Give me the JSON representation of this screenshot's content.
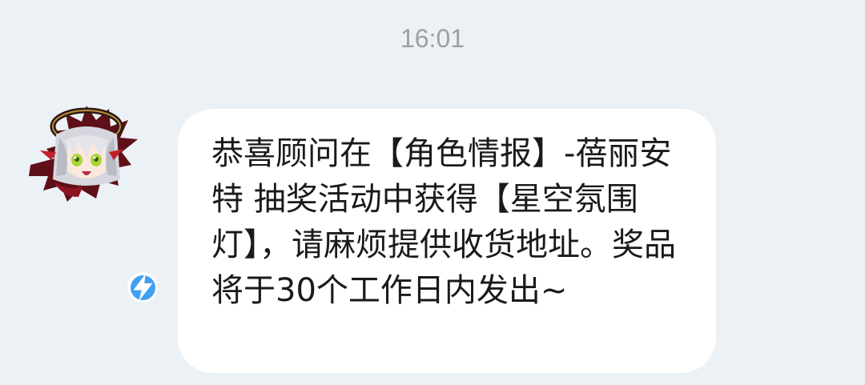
{
  "chat": {
    "timestamp": "16:01",
    "messages": [
      {
        "sender_avatar_icon": "anime-character-avatar-icon",
        "badge_icon": "lightning-verified-badge-icon",
        "text": "恭喜顾问在【角色情报】-蓓丽安特 抽奖活动中获得【星空氛围灯】，请麻烦提供收货地址。奖品将于30个工作日内发出~"
      }
    ]
  },
  "colors": {
    "background": "#ecf1f6",
    "bubble": "#ffffff",
    "text": "#1a1a1a",
    "timestamp": "#9aa0a6",
    "badge": "#3fa0f4"
  }
}
